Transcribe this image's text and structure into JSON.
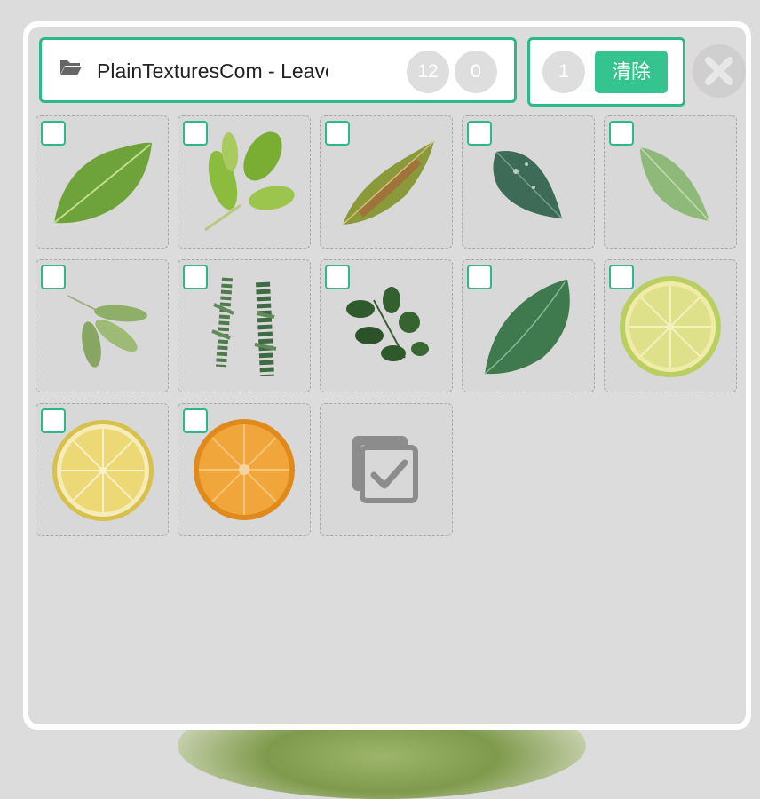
{
  "folder": {
    "icon": "folder-open-icon",
    "title": "PlainTexturesCom - Leaves",
    "total_count": "12",
    "selected_count": "0"
  },
  "selection": {
    "count": "1",
    "clear_label": "清除"
  },
  "close_icon": "close-icon",
  "accent_color": "#2fb88b",
  "items": [
    {
      "name": "leaf-green-serrated",
      "checked": false
    },
    {
      "name": "leaf-cluster-yellow-green",
      "checked": false
    },
    {
      "name": "leaf-red-green-narrow",
      "checked": false
    },
    {
      "name": "leaf-dark-green-dewdrops",
      "checked": false
    },
    {
      "name": "leaf-pale-green",
      "checked": false
    },
    {
      "name": "leaf-trifoliate-light-green",
      "checked": false
    },
    {
      "name": "cedar-sprigs",
      "checked": false
    },
    {
      "name": "rose-leaf-cluster",
      "checked": false
    },
    {
      "name": "leaf-dark-green-large",
      "checked": false
    },
    {
      "name": "lime-slice",
      "checked": false
    },
    {
      "name": "lemon-slice",
      "checked": false
    },
    {
      "name": "orange-slice",
      "checked": false
    }
  ],
  "select_all_icon": "multi-select-checkbox-icon"
}
